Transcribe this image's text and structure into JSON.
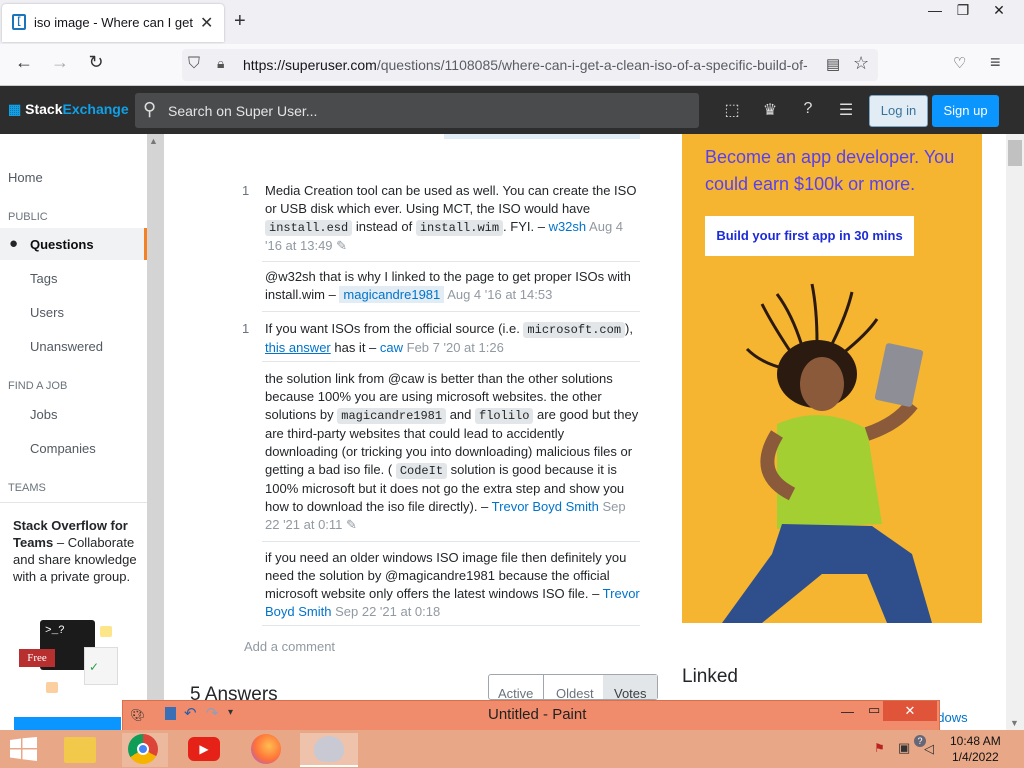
{
  "browser": {
    "tab_title": "iso image - Where can I get a cl",
    "tab_close": "✕",
    "new_tab": "+",
    "window_minimize": "—",
    "window_restore": "❐",
    "window_close": "✕",
    "url_host": "https://superuser.com",
    "url_path": "/questions/1108085/where-can-i-get-a-clean-iso-of-a-specific-build-of-"
  },
  "header": {
    "logo_a": "Stack",
    "logo_b": "Exchange",
    "search_placeholder": "Search on Super User...",
    "login": "Log in",
    "signup": "Sign up"
  },
  "leftnav": {
    "home": "Home",
    "public": "PUBLIC",
    "questions": "Questions",
    "tags": "Tags",
    "users": "Users",
    "unanswered": "Unanswered",
    "find_job": "FIND A JOB",
    "jobs": "Jobs",
    "companies": "Companies",
    "teams": "TEAMS",
    "teams_title": "Stack Overflow for Teams",
    "teams_desc": " – Collaborate and share knowledge with a private group.",
    "free_badge": "Free",
    "terminal": ">_?"
  },
  "comments": [
    {
      "score": "1",
      "pre": "Media Creation tool can be used as well. You can create the ISO or USB disk which ever. Using MCT, the ISO would have ",
      "code1": "install.esd",
      "mid": " instead of ",
      "code2": "install.wim",
      "post": ". FYI. – ",
      "user": "w32sh",
      "time": "Aug 4 '16 at 13:49"
    },
    {
      "score": "",
      "text": "@w32sh that is why I linked to the page to get proper ISOs with install.wim – ",
      "user": "magicandre1981",
      "time": "Aug 4 '16 at 14:53"
    },
    {
      "score": "1",
      "pre": "If you want ISOs from the official source (i.e. ",
      "code1": "microsoft.com",
      "mid": "), ",
      "link": "this answer",
      "post": " has it – ",
      "user": "caw",
      "time": "Feb 7 '20 at 1:26"
    },
    {
      "score": "",
      "t1": "the solution link from @caw is better than the other solutions because 100% you are using microsoft websites. the other solutions by ",
      "code1": "magicandre1981",
      "t2": " and ",
      "code2": "flolilo",
      "t3": " are good but they are third-party websites that could lead to accidently downloading (or tricking you into downloading) malicious files or getting a bad iso file. ( ",
      "code3": "CodeIt",
      "t4": " solution is good because it is 100% microsoft but it does not go the extra step and show you how to download the iso file directly). – ",
      "user": "Trevor Boyd Smith",
      "time": "Sep 22 '21 at 0:11"
    },
    {
      "score": "",
      "text": "if you need an older windows ISO image file then definitely you need the solution by @magicandre1981 because the official microsoft website only offers the latest windows ISO file. – ",
      "user": "Trevor Boyd Smith",
      "time": "Sep 22 '21 at 0:18"
    }
  ],
  "add_comment": "Add a comment",
  "answers_heading": "5 Answers",
  "sort_tabs": [
    "Active",
    "Oldest",
    "Votes"
  ],
  "linked_heading": "Linked",
  "linked_fragment": "ndows",
  "ad": {
    "headline": "Become an app developer. You could earn $100k or more.",
    "button": "Build your first app in 30 mins"
  },
  "paint": {
    "title": "Untitled - Paint"
  },
  "taskbar": {
    "time": "10:48 AM",
    "date": "1/4/2022"
  },
  "colors": {
    "accent_orange": "#f48225",
    "link_blue": "#0074cc",
    "ad_bg": "#f6b530",
    "ad_text": "#5a3ff0"
  }
}
